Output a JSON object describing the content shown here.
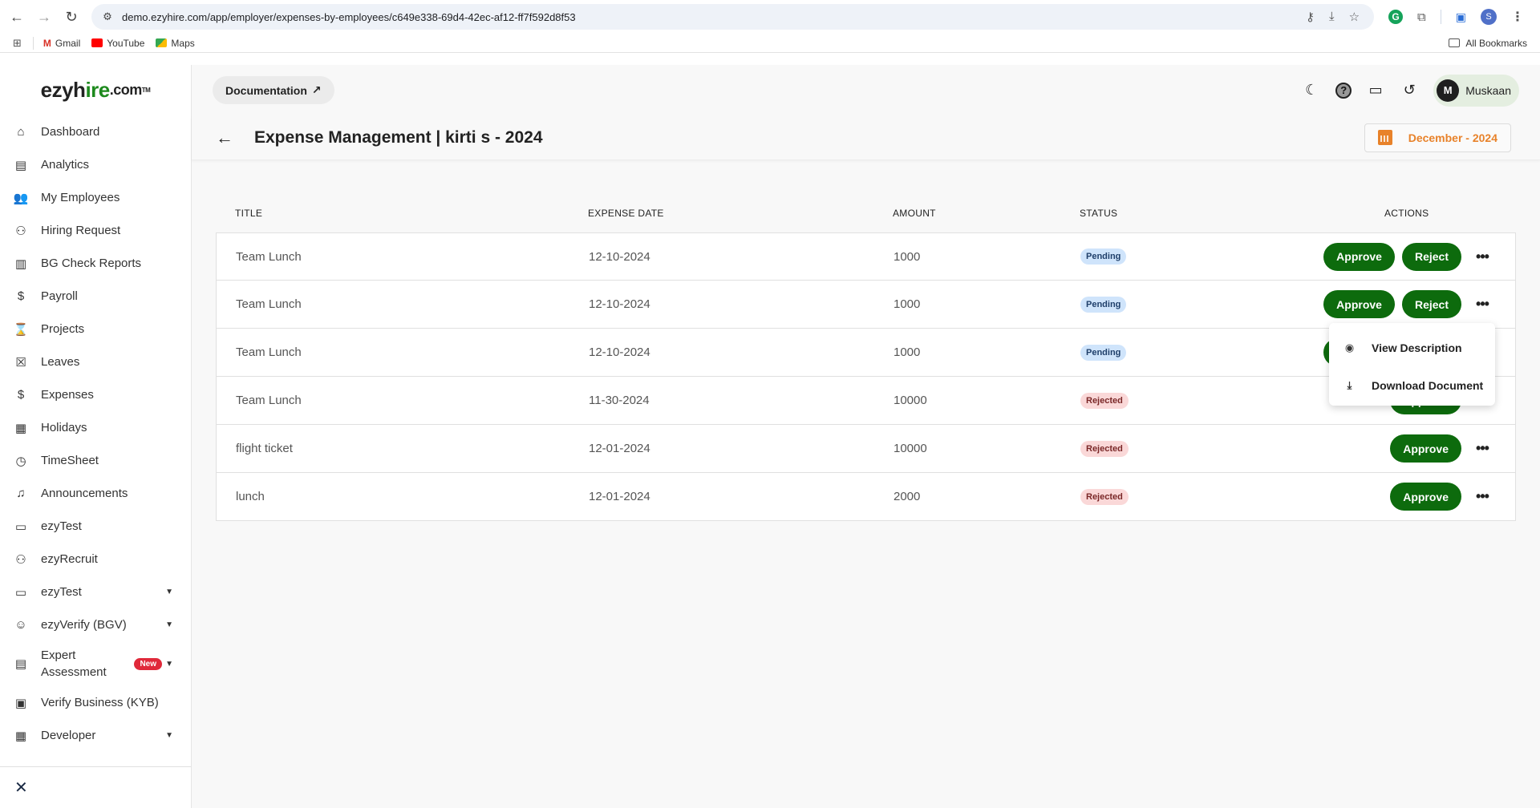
{
  "browser": {
    "url": "demo.ezyhire.com/app/employer/expenses-by-employees/c649e338-69d4-42ec-af12-ff7f592d8f53",
    "profile_initial": "S",
    "bookmarks": [
      {
        "label": "Gmail",
        "icon": "gmail-icon"
      },
      {
        "label": "YouTube",
        "icon": "youtube-icon"
      },
      {
        "label": "Maps",
        "icon": "maps-icon"
      }
    ],
    "all_bookmarks_label": "All Bookmarks"
  },
  "sidebar": {
    "logo": {
      "part1": "ezyh",
      "part2": "ire",
      "part3": ".com",
      "tm": "TM"
    },
    "items": [
      {
        "label": "Dashboard",
        "icon": "home-icon",
        "glyph": "⌂"
      },
      {
        "label": "Analytics",
        "icon": "analytics-icon",
        "glyph": "▤"
      },
      {
        "label": "My Employees",
        "icon": "employees-icon",
        "glyph": "👥"
      },
      {
        "label": "Hiring Request",
        "icon": "person-add-icon",
        "glyph": "⚇"
      },
      {
        "label": "BG Check Reports",
        "icon": "report-icon",
        "glyph": "▥"
      },
      {
        "label": "Payroll",
        "icon": "dollar-icon",
        "glyph": "$"
      },
      {
        "label": "Projects",
        "icon": "briefcase-clock-icon",
        "glyph": "⌛"
      },
      {
        "label": "Leaves",
        "icon": "calendar-x-icon",
        "glyph": "☒"
      },
      {
        "label": "Expenses",
        "icon": "receipt-icon",
        "glyph": "$"
      },
      {
        "label": "Holidays",
        "icon": "calendar-icon",
        "glyph": "▦"
      },
      {
        "label": "TimeSheet",
        "icon": "clock-icon",
        "glyph": "◷"
      },
      {
        "label": "Announcements",
        "icon": "bell-icon",
        "glyph": "♫"
      },
      {
        "label": "ezyTest",
        "icon": "chat-icon",
        "glyph": "▭"
      },
      {
        "label": "ezyRecruit",
        "icon": "recruit-icon",
        "glyph": "⚇"
      },
      {
        "label": "ezyTest",
        "icon": "chat-icon",
        "glyph": "▭",
        "caret": true
      },
      {
        "label": "ezyVerify (BGV)",
        "icon": "verify-face-icon",
        "glyph": "☺",
        "caret": true
      },
      {
        "label": "Expert Assessment",
        "icon": "clipboard-icon",
        "glyph": "▤",
        "caret": true,
        "badge": "New"
      },
      {
        "label": "Verify Business (KYB)",
        "icon": "business-icon",
        "glyph": "▣"
      },
      {
        "label": "Developer",
        "icon": "developer-icon",
        "glyph": "▦",
        "caret": true
      }
    ],
    "close_label": "✕"
  },
  "topbar": {
    "documentation_label": "Documentation",
    "user_initial": "M",
    "user_name": "Muskaan"
  },
  "page": {
    "title": "Expense Management | kirti s - 2024",
    "month": "December - 2024"
  },
  "table": {
    "columns": [
      "TITLE",
      "EXPENSE DATE",
      "AMOUNT",
      "STATUS",
      "ACTIONS"
    ],
    "rows": [
      {
        "title": "Team Lunch",
        "date": "12-10-2024",
        "amount": "1000",
        "status": "Pending"
      },
      {
        "title": "Team Lunch",
        "date": "12-10-2024",
        "amount": "1000",
        "status": "Pending"
      },
      {
        "title": "Team Lunch",
        "date": "12-10-2024",
        "amount": "1000",
        "status": "Pending"
      },
      {
        "title": "Team Lunch",
        "date": "11-30-2024",
        "amount": "10000",
        "status": "Rejected"
      },
      {
        "title": "flight ticket",
        "date": "12-01-2024",
        "amount": "10000",
        "status": "Rejected"
      },
      {
        "title": "lunch",
        "date": "12-01-2024",
        "amount": "2000",
        "status": "Rejected"
      }
    ],
    "approve_label": "Approve",
    "reject_label": "Reject"
  },
  "context_menu": {
    "items": [
      {
        "label": "View Description",
        "icon": "eye-icon"
      },
      {
        "label": "Download Document",
        "icon": "download-icon"
      }
    ]
  },
  "colors": {
    "primary_green": "#0d6b0d",
    "accent_orange": "#e8822a",
    "pending_bg": "#cfe4fb",
    "rejected_bg": "#fad8d8",
    "new_badge": "#e0293a"
  }
}
